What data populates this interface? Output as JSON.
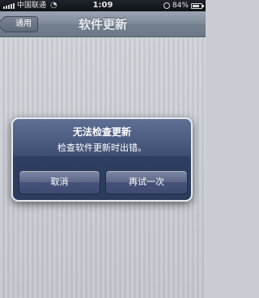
{
  "status_bar": {
    "carrier": "中国联通",
    "time": "1:09",
    "battery_percent": "84%",
    "battery_level": 0.84
  },
  "nav": {
    "back_label": "通用",
    "title": "软件更新"
  },
  "alert": {
    "title": "无法检查更新",
    "message": "检查软件更新时出错。",
    "cancel_label": "取消",
    "retry_label": "再试一次"
  }
}
